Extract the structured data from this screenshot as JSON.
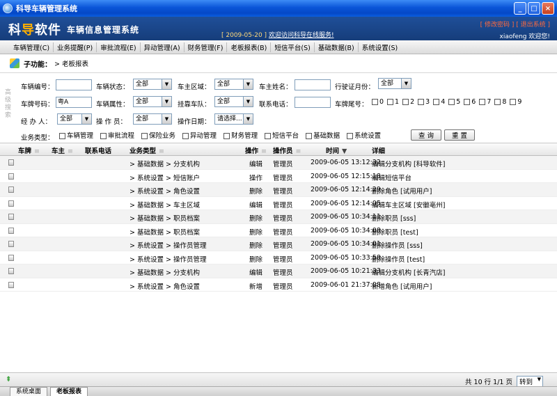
{
  "window": {
    "title": "科导车辆管理系统"
  },
  "header": {
    "brand_a": "科",
    "brand_b": "导",
    "brand_c": "软件",
    "subtitle": "车辆信息管理系统",
    "notice_date": "[ 2009-05-20 ]",
    "notice_link": "欢迎访问科导在线服务!",
    "links": "[ 修改密码 ]  [ 退出系统 ]",
    "user": "xiaofeng  欢迎您!"
  },
  "menu": [
    "车辆管理(C)",
    "业务提醒(P)",
    "审批流程(E)",
    "异动管理(A)",
    "财务管理(F)",
    "老板报表(B)",
    "短信平台(S)",
    "基础数据(B)",
    "系统设置(S)"
  ],
  "subbar": {
    "label": "子功能：",
    "crumb": "> 老板报表"
  },
  "filters": {
    "side_label": "高级搜索",
    "vehicle_no": "车辆编号：",
    "vehicle_status": "车辆状态：",
    "vehicle_status_val": "全部",
    "owner_region": "车主区域：",
    "owner_region_val": "全部",
    "owner_name": "车主姓名：",
    "license_month": "行驶证月份：",
    "license_month_val": "全部",
    "plate_no": "车牌号码：",
    "plate_no_val": "粤A",
    "vehicle_attr": "车辆属性：",
    "vehicle_attr_val": "全部",
    "team": "挂靠车队：",
    "team_val": "全部",
    "phone": "联系电话：",
    "plate_tail": "车牌尾号：",
    "digits": [
      "0",
      "1",
      "2",
      "3",
      "4",
      "5",
      "6",
      "7",
      "8",
      "9"
    ],
    "agent": "经 办 人：",
    "agent_val": "全部",
    "operator": "操 作 员：",
    "operator_val": "全部",
    "op_date": "操作日期：",
    "op_date_val": "请选择...",
    "biz_type": "业务类型：",
    "biz_options": [
      "车辆管理",
      "审批流程",
      "保险业务",
      "异动管理",
      "财务管理",
      "短信平台",
      "基础数据",
      "系统设置"
    ],
    "query_btn": "查 询",
    "reset_btn": "重 置"
  },
  "grid": {
    "headers": {
      "plate": "车牌",
      "owner": "车主",
      "phone": "联系电话",
      "biz": "业务类型",
      "op": "操作",
      "operator": "操作员",
      "time": "时间",
      "detail": "详细"
    },
    "rows": [
      {
        "biz": "> 基础数据 > 分支机构",
        "op": "编辑",
        "operator": "管理员",
        "time": "2009-06-05 13:12:32",
        "detail": "编辑分支机构 [科导软件]"
      },
      {
        "biz": "> 系统设置 > 短信账户",
        "op": "操作",
        "operator": "管理员",
        "time": "2009-06-05 12:15:18",
        "detail": "编辑短信平台"
      },
      {
        "biz": "> 系统设置 > 角色设置",
        "op": "删除",
        "operator": "管理员",
        "time": "2009-06-05 12:14:29",
        "detail": "删除角色 [试用用户]"
      },
      {
        "biz": "> 基础数据 > 车主区域",
        "op": "编辑",
        "operator": "管理员",
        "time": "2009-06-05 12:14:05",
        "detail": "编辑车主区域 [安徽亳州]"
      },
      {
        "biz": "> 基础数据 > 职员档案",
        "op": "删除",
        "operator": "管理员",
        "time": "2009-06-05 10:34:11",
        "detail": "删除职员 [sss]"
      },
      {
        "biz": "> 基础数据 > 职员档案",
        "op": "删除",
        "operator": "管理员",
        "time": "2009-06-05 10:34:08",
        "detail": "删除职员 [test]"
      },
      {
        "biz": "> 系统设置 > 操作员管理",
        "op": "删除",
        "operator": "管理员",
        "time": "2009-06-05 10:34:01",
        "detail": "删除操作员 [sss]"
      },
      {
        "biz": "> 系统设置 > 操作员管理",
        "op": "删除",
        "operator": "管理员",
        "time": "2009-06-05 10:33:58",
        "detail": "删除操作员 [test]"
      },
      {
        "biz": "> 基础数据 > 分支机构",
        "op": "编辑",
        "operator": "管理员",
        "time": "2009-06-05 10:21:33",
        "detail": "编辑分支机构 [长青汽店]"
      },
      {
        "biz": "> 系统设置 > 角色设置",
        "op": "新增",
        "operator": "管理员",
        "time": "2009-06-01 21:37:08",
        "detail": "新增角色 [试用用户]"
      }
    ]
  },
  "status": {
    "summary": "共 10 行  1/1 页",
    "goto": "转到"
  },
  "tabs": [
    "系统桌面",
    "老板报表"
  ]
}
